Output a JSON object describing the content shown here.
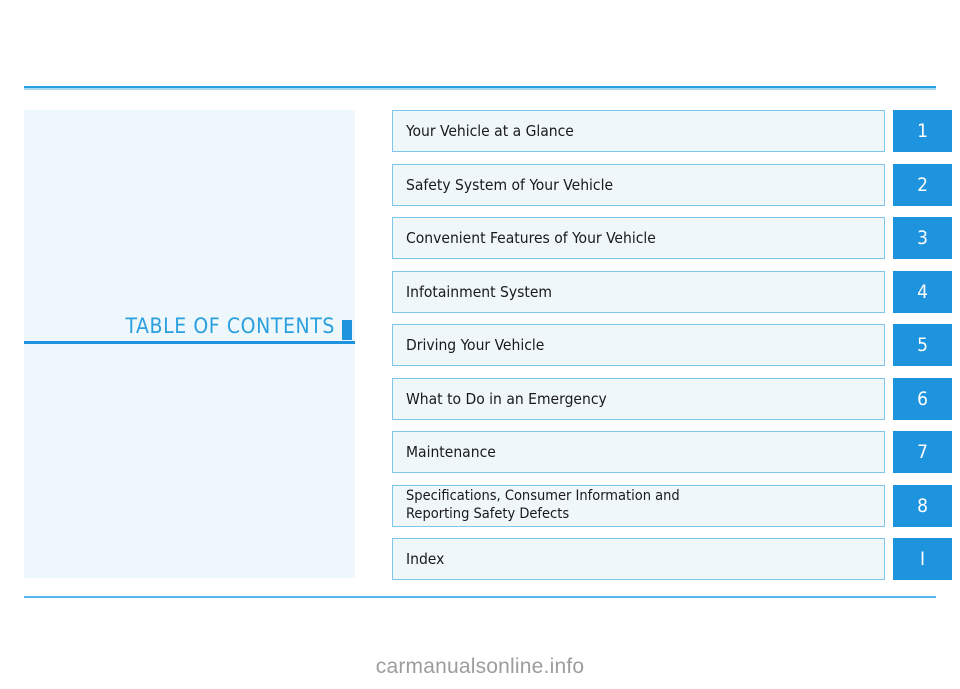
{
  "page": {
    "title": "TABLE OF CONTENTS",
    "watermark": "carmanualsonline.info",
    "accent_color": "#1f94de",
    "rule_color_dark": "#2a9fe0",
    "rule_color_light": "#a8daf2",
    "panel_background": "#eef7fb",
    "row_background": "#eff7fb",
    "row_border_color": "#7fc6ea",
    "badge_background": "#1f94de",
    "badge_text_color": "#ffffff",
    "text_color": "#1a1a1a",
    "watermark_color": "#9d9d9d"
  },
  "contents": [
    {
      "label": "Your Vehicle at a Glance",
      "badge": "1",
      "two_line": false
    },
    {
      "label": "Safety System of Your Vehicle",
      "badge": "2",
      "two_line": false
    },
    {
      "label": "Convenient Features of Your Vehicle",
      "badge": "3",
      "two_line": false
    },
    {
      "label": "Infotainment System",
      "badge": "4",
      "two_line": false
    },
    {
      "label": "Driving Your Vehicle",
      "badge": "5",
      "two_line": false
    },
    {
      "label": "What to Do in an Emergency",
      "badge": "6",
      "two_line": false
    },
    {
      "label": "Maintenance",
      "badge": "7",
      "two_line": false
    },
    {
      "label": "Specifications, Consumer Information and\nReporting Safety Defects",
      "badge": "8",
      "two_line": true
    },
    {
      "label": "Index",
      "badge": "I",
      "two_line": false
    }
  ]
}
